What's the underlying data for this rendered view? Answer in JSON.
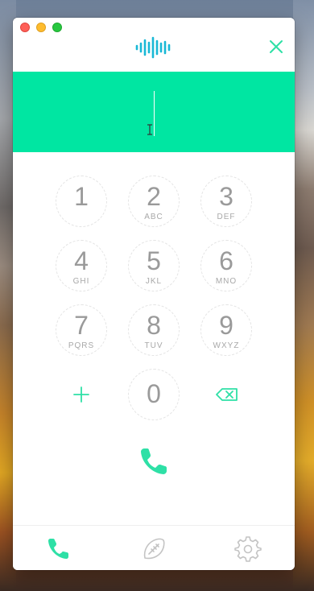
{
  "colors": {
    "accent": "#00e6a2",
    "accent_icon": "#2ee0a6",
    "key_text": "#9a9a9a",
    "muted_icon": "#c4c4c4"
  },
  "window": {
    "traffic_lights": [
      "close",
      "minimize",
      "maximize"
    ]
  },
  "header": {
    "logo_icon": "soundwave-logo-icon",
    "close_icon": "close-icon"
  },
  "display": {
    "number": ""
  },
  "keypad": {
    "keys": [
      {
        "digit": "1",
        "letters": ""
      },
      {
        "digit": "2",
        "letters": "ABC"
      },
      {
        "digit": "3",
        "letters": "DEF"
      },
      {
        "digit": "4",
        "letters": "GHI"
      },
      {
        "digit": "5",
        "letters": "JKL"
      },
      {
        "digit": "6",
        "letters": "MNO"
      },
      {
        "digit": "7",
        "letters": "PQRS"
      },
      {
        "digit": "8",
        "letters": "TUV"
      },
      {
        "digit": "9",
        "letters": "WXYZ"
      },
      {
        "digit": "0",
        "letters": ""
      }
    ],
    "plus_icon": "plus-icon",
    "backspace_icon": "backspace-icon"
  },
  "call": {
    "icon": "phone-icon"
  },
  "tabs": [
    {
      "icon": "phone-icon",
      "active": true
    },
    {
      "icon": "football-icon",
      "active": false
    },
    {
      "icon": "gear-icon",
      "active": false
    }
  ]
}
